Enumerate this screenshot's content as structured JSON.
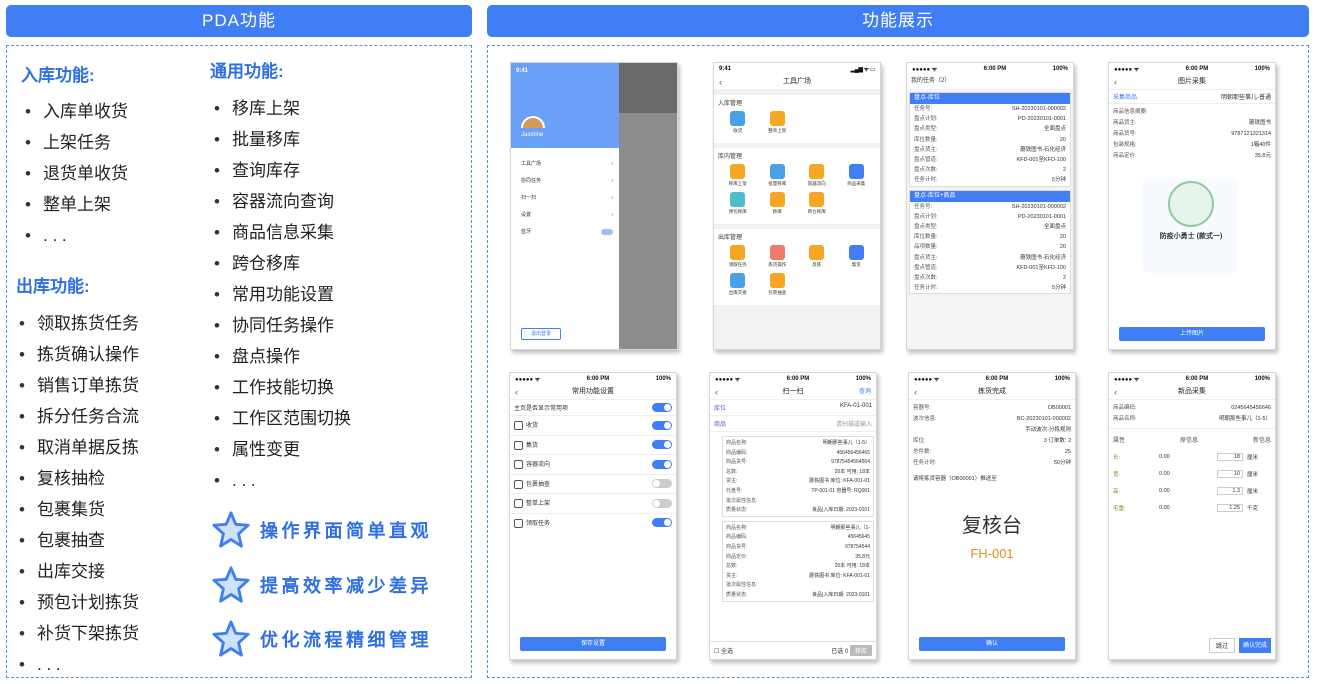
{
  "headers": {
    "left": "PDA功能",
    "right": "功能展示"
  },
  "inbound": {
    "title": "入库功能:",
    "items": [
      "入库单收货",
      "上架任务",
      "退货单收货",
      "整单上架",
      ". . ."
    ]
  },
  "outbound": {
    "title": "出库功能:",
    "items": [
      "领取拣货任务",
      "拣货确认操作",
      "销售订单拣货",
      "拆分任务合流",
      "取消单据反拣",
      "复核抽检",
      "包裹集货",
      "包裹抽查",
      "出库交接",
      "预包计划拣货",
      "补货下架拣货",
      ". . ."
    ]
  },
  "general": {
    "title": "通用功能:",
    "items": [
      "移库上架",
      "批量移库",
      "查询库存",
      "容器流向查询",
      "商品信息采集",
      "跨仓移库",
      "常用功能设置",
      "协同任务操作",
      "盘点操作",
      "工作技能切换",
      "工作区范围切换",
      "属性变更",
      ". . ."
    ]
  },
  "features": [
    "操作界面简单直观",
    "提高效率减少差异",
    "优化流程精细管理"
  ],
  "colors": {
    "accent": "#3f7ef4",
    "title_blue": "#2f6fe0",
    "orange": "#f5a623"
  },
  "phone1": {
    "time": "9:41",
    "user": "Jasmine",
    "menu": [
      "工具广场",
      "协同任务",
      "扫一扫",
      "设置",
      "蓝牙"
    ],
    "logout": "退出登录"
  },
  "phone2": {
    "time": "9:41",
    "title": "工具广场",
    "sections": [
      {
        "name": "入库管理",
        "items": [
          "收货",
          "整单上架"
        ]
      },
      {
        "name": "库内管理",
        "items": [
          "移库上架",
          "批量移库",
          "容器流向",
          "商品采集",
          "预包移库",
          "移库",
          "跨仓移库"
        ]
      },
      {
        "name": "出库管理",
        "items": [
          "领取任务",
          "拣货操作",
          "反拣",
          "集货",
          "出库交接",
          "包裹抽查"
        ]
      }
    ]
  },
  "phone3": {
    "carrier": "●●●●● ᯤ",
    "time": "6:00 PM",
    "battery": "100%",
    "title": "我的任务（2）",
    "cards": [
      {
        "header": "盘点-库位",
        "rows": [
          [
            "任务号:",
            "SH-20230101-000002"
          ],
          [
            "盘点计划:",
            "PD-20230101-0001"
          ],
          [
            "盘点类型:",
            "全面盘点"
          ],
          [
            "库位数量:",
            "20"
          ],
          [
            "盘点货主:",
            "蘑铁图书-石化经济"
          ],
          [
            "盘点管道:",
            "KFD-001至KFD-100"
          ],
          [
            "盘点次数:",
            "2"
          ],
          [
            "任务计时:",
            "5分钟"
          ]
        ]
      },
      {
        "header": "盘点-库位+商品",
        "rows": [
          [
            "任务号:",
            "SH-20230101-000002"
          ],
          [
            "盘点计划:",
            "PD-20230101-0001"
          ],
          [
            "盘点类型:",
            "全面盘点"
          ],
          [
            "库位数量:",
            "20"
          ],
          [
            "品项数量:",
            "20"
          ],
          [
            "盘点货主:",
            "蘑铁图书-石化经济"
          ],
          [
            "盘点管道:",
            "KFD-001至KFD-100"
          ],
          [
            "盘点次数:",
            "2"
          ],
          [
            "任务计时:",
            "5分钟"
          ]
        ]
      }
    ]
  },
  "phone4": {
    "carrier": "●●●●● ᯤ",
    "time": "6:00 PM",
    "battery": "100%",
    "title": "图片采集",
    "tab": "采集商品",
    "tab_value": "明朝那些事儿-普通",
    "rows": [
      [
        "商品信息摘要:",
        ""
      ],
      [
        "商品货主:",
        "蘑铁图书"
      ],
      [
        "商品货号:",
        "9787121321314"
      ],
      [
        "包装规格:",
        "1箱40件"
      ],
      [
        "商品定价:",
        "35.8元"
      ]
    ],
    "badge": "防疫小勇士 (款式一)",
    "button": "上传图片"
  },
  "phone5": {
    "carrier": "●●●●● ᯤ",
    "time": "6:00 PM",
    "battery": "100%",
    "title": "常用功能设置",
    "main_label": "主页是否显示常用项",
    "toggle_on": "开",
    "items": [
      {
        "label": "收货",
        "on": true
      },
      {
        "label": "集货",
        "on": true
      },
      {
        "label": "容器流向",
        "on": true
      },
      {
        "label": "包裹抽查",
        "on": false
      },
      {
        "label": "整单上架",
        "on": false
      },
      {
        "label": "领取任务",
        "on": true
      }
    ],
    "button": "保存设置"
  },
  "phone6": {
    "carrier": "●●●●● ᯤ",
    "time": "6:00 PM",
    "battery": "100%",
    "title": "扫一扫",
    "query": "查询",
    "location_label": "库位",
    "location_value": "KFA-01-001",
    "goods_label": "商品",
    "goods_placeholder": "请扫描或输入",
    "item1": [
      [
        "商品名称:",
        "明朝那些事儿（1-5）"
      ],
      [
        "商品编码:",
        "456456456465"
      ],
      [
        "商品货号:",
        "97875454564564"
      ],
      [
        "总数:",
        "20本  可用:  18本"
      ],
      [
        "货主:",
        "蘑铁图书  库位:  KFA-001-01"
      ],
      [
        "托盘号:",
        "TP-001-01  容器号:  RQ001"
      ],
      [
        "批次属性信息:",
        ""
      ],
      [
        "质量状态:",
        "良品|入库日期: 2023-0101"
      ]
    ],
    "item2": [
      [
        "商品名称:",
        "明朝那些事儿（1-"
      ],
      [
        "商品编码:",
        "45645645"
      ],
      [
        "商品货号:",
        "978754544"
      ],
      [
        "商品定价:",
        "35.8元"
      ],
      [
        "总数:",
        "20本  可用:  18本"
      ],
      [
        "货主:",
        "蘑铁图书  库位:  KFA-001-01"
      ],
      [
        "批次属性信息:",
        ""
      ],
      [
        "质量状态:",
        "良品|入库日期: 2023-0101"
      ]
    ],
    "select_all": "全选",
    "selected": "已选 0",
    "action": "移库"
  },
  "phone7": {
    "carrier": "●●●●● ᯤ",
    "time": "6:00 PM",
    "battery": "100%",
    "title": "拣货完成",
    "rows": [
      [
        "容器号:",
        "OB00001"
      ],
      [
        "波次信息:",
        "BC-20230101-000002"
      ],
      [
        "",
        "手动波次-分拣规则"
      ],
      [
        "库位:",
        "3   订单数:   2"
      ],
      [
        "总件数:",
        "25"
      ],
      [
        "任务计时:",
        "50分钟"
      ]
    ],
    "prompt": "请将拣货容器（OB00001）推送至",
    "station": "复核台",
    "code": "FH-001",
    "button": "确认"
  },
  "phone8": {
    "carrier": "●●●●● ᯤ",
    "time": "6:00 PM",
    "battery": "100%",
    "title": "新品采集",
    "code_label": "商品编码:",
    "code_value": "0245645456646",
    "name_label": "商品名称:",
    "name_value": "明朝那些事儿（1-5）",
    "cols": [
      "属性",
      "原信息",
      "新信息"
    ],
    "rows": [
      {
        "attr": "长:",
        "old": "0.00",
        "new": "18",
        "unit": "厘米"
      },
      {
        "attr": "宽:",
        "old": "0.00",
        "new": "10",
        "unit": "厘米"
      },
      {
        "attr": "高:",
        "old": "0.00",
        "new": "1.3",
        "unit": "厘米"
      },
      {
        "attr": "毛重:",
        "old": "0.00",
        "new": "1.25",
        "unit": "千克"
      }
    ],
    "skip": "跳过",
    "done": "确认完成"
  }
}
